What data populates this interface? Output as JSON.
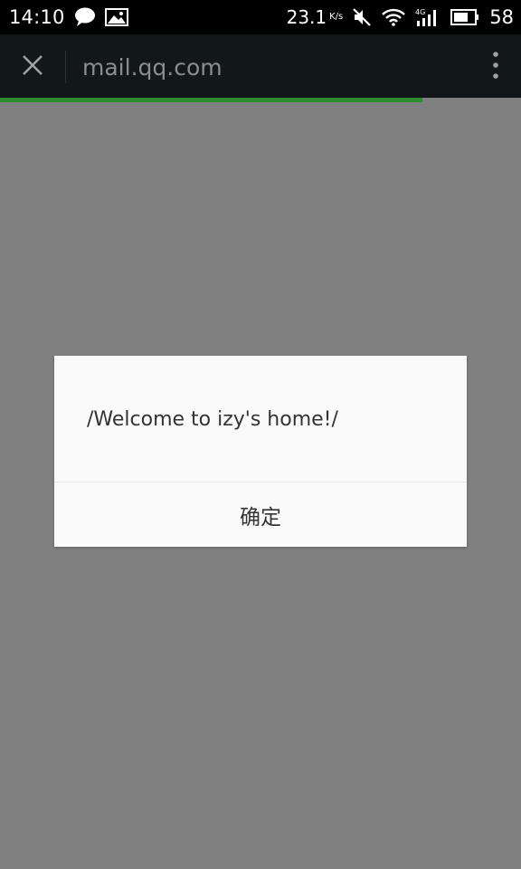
{
  "status_bar": {
    "time": "14:10",
    "network_speed": "23.1",
    "network_speed_unit": "K/s",
    "battery": "58",
    "icons": [
      "chat-bubble-icon",
      "image-icon",
      "mute-icon",
      "wifi-icon",
      "signal-4g-icon",
      "battery-icon"
    ]
  },
  "toolbar": {
    "url": "mail.qq.com",
    "icons": [
      "close-icon",
      "more-vert-icon"
    ]
  },
  "progress": {
    "fraction": 0.81,
    "color": "#2e8b2e"
  },
  "dialog": {
    "message": "/Welcome to izy's home!/",
    "confirm_label": "确定"
  },
  "colors": {
    "background_dim": "#808080",
    "toolbar": "#12171a",
    "dialog": "#fafafa"
  }
}
